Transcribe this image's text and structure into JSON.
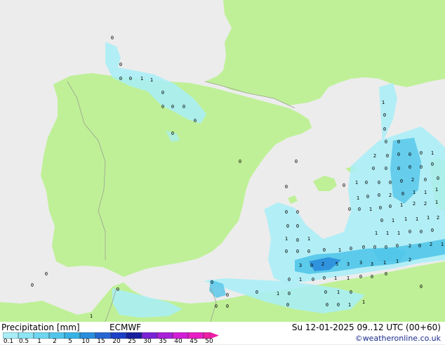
{
  "legend": {
    "title": "Precipitation [mm]",
    "model": "ECMWF",
    "ticks": [
      "0.1",
      "0.5",
      "1",
      "2",
      "5",
      "10",
      "15",
      "20",
      "25",
      "30",
      "35",
      "40",
      "45",
      "50"
    ],
    "colors": [
      "#a8eef8",
      "#8ce4f4",
      "#6ed6ef",
      "#52c6ea",
      "#38b2e4",
      "#2a8edc",
      "#2666d2",
      "#1e3fc8",
      "#16209e",
      "#7a22d6",
      "#a820d8",
      "#d21ed6",
      "#e81ec4",
      "#f01ea8"
    ]
  },
  "valid_time": "Su 12-01-2025 09..12 UTC (00+60)",
  "credit": "©weatheronline.co.uk",
  "map_colors": {
    "land": "#bff097",
    "sea": "#ececec",
    "border": "#9aa08f",
    "rain_light": "#a8eef8",
    "rain_mid": "#52c6ea",
    "rain_heavy": "#2a8edc"
  },
  "precip_labels": [
    "0",
    "0",
    "0",
    "0",
    "1",
    "1",
    "0",
    "0",
    "0",
    "0",
    "0",
    "0",
    "0",
    "0",
    "0",
    "1",
    "0",
    "0",
    "0",
    "0",
    "2",
    "0",
    "0",
    "0",
    "0",
    "1",
    "0",
    "0",
    "0",
    "0",
    "0",
    "0",
    "0",
    "1",
    "0",
    "0",
    "0",
    "0",
    "2",
    "0",
    "0",
    "1",
    "0",
    "0",
    "2",
    "0",
    "1",
    "1",
    "1",
    "0",
    "0",
    "1",
    "0",
    "0",
    "1",
    "2",
    "2",
    "1",
    "0",
    "0",
    "0",
    "1",
    "1",
    "1",
    "1",
    "2",
    "1",
    "1",
    "1",
    "0",
    "0",
    "0",
    "2",
    "0",
    "0",
    "0",
    "0",
    "0",
    "1",
    "0",
    "0",
    "0",
    "0",
    "1",
    "0",
    "1",
    "0",
    "0",
    "0",
    "2",
    "1",
    "3",
    "0",
    "2",
    "5",
    "3",
    "3",
    "3",
    "1",
    "1",
    "2",
    "0",
    "1",
    "0",
    "0",
    "1",
    "1",
    "0",
    "0",
    "0",
    "0",
    "0",
    "0",
    "0",
    "0",
    "1",
    "0",
    "0",
    "0",
    "1",
    "0",
    "1",
    "1",
    "0",
    "0",
    "0",
    "1",
    "0",
    "0",
    "0"
  ]
}
